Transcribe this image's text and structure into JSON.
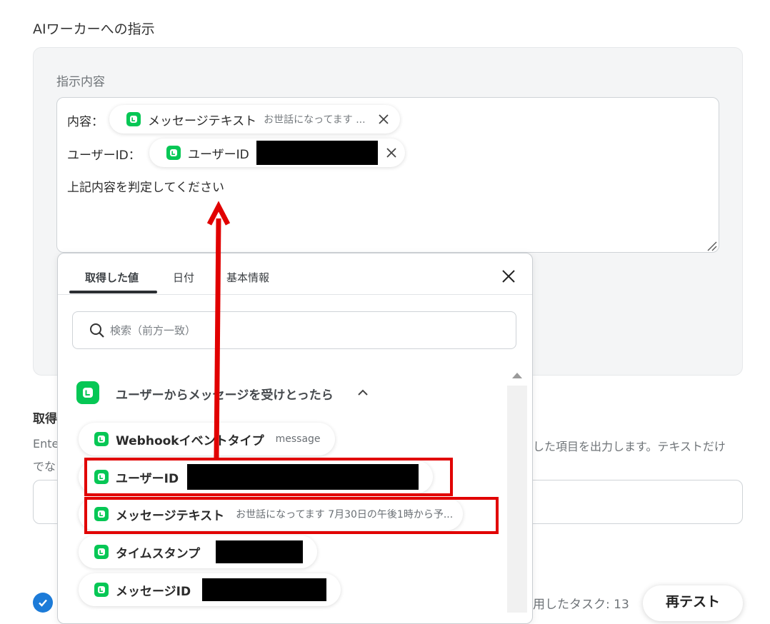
{
  "section": {
    "title": "AIワーカーへの指示"
  },
  "instruction_field": {
    "label": "指示内容",
    "line1_label": "内容：",
    "line1_pill": {
      "name": "メッセージテキスト",
      "value": "お世話になってます ..."
    },
    "line2_label": "ユーザーID：",
    "line2_pill": {
      "name": "ユーザーID"
    },
    "body_text": "上記内容を判定してください"
  },
  "background": {
    "title": "取得",
    "desc_left": "Ente",
    "desc_right": "した項目を出力します。テキストだけ",
    "desc_line2": "でな",
    "task_text": "用したタスク: 13",
    "retest_label": "再テスト"
  },
  "dropdown": {
    "tabs": [
      {
        "label": "取得した値",
        "active": true
      },
      {
        "label": "日付",
        "active": false
      },
      {
        "label": "基本情報",
        "active": false
      }
    ],
    "search": {
      "placeholder": "検索（前方一致）"
    },
    "group": {
      "title": "ユーザーからメッセージを受けとったら",
      "items": [
        {
          "name": "Webhookイベントタイプ",
          "value": "message"
        },
        {
          "name": "ユーザーID",
          "value": ""
        },
        {
          "name": "メッセージテキスト",
          "value": "お世話になってます 7月30日の午後1時から予..."
        },
        {
          "name": "タイムスタンプ",
          "value": ""
        },
        {
          "name": "メッセージID",
          "value": ""
        }
      ]
    }
  },
  "colors": {
    "line_green": "#06c755",
    "highlight_red": "#e10000",
    "arrow_red": "#e10000",
    "check_blue": "#1c7bd8"
  }
}
